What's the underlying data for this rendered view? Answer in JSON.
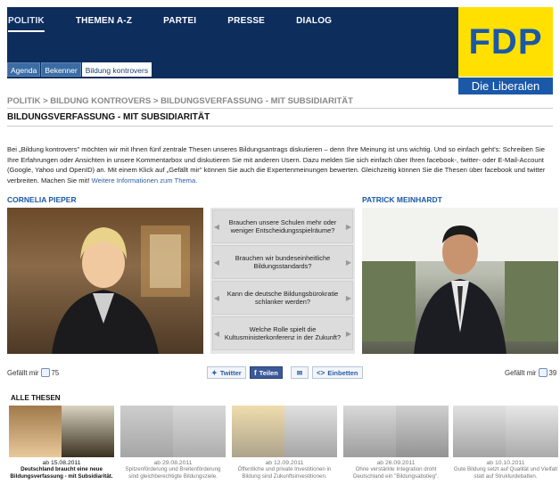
{
  "nav": {
    "items": [
      "POLITIK",
      "THEMEN A-Z",
      "PARTEI",
      "PRESSE",
      "DIALOG"
    ]
  },
  "subtabs": [
    "Agenda",
    "Bekenner",
    "Bildung kontrovers"
  ],
  "logo": {
    "name": "FDP",
    "tagline": "Die Liberalen"
  },
  "breadcrumb": "POLITIK > BILDUNG KONTROVERS > BILDUNGSVERFASSUNG - MIT SUBSIDIARITÄT",
  "page_title": "BILDUNGSVERFASSUNG - MIT SUBSIDIARITÄT",
  "intro": {
    "text": "Bei „Bildung kontrovers\" möchten wir mit Ihnen fünf zentrale Thesen unseres Bildungsantrags diskutieren – denn Ihre Meinung ist uns wichtig. Und so einfach geht's: Schreiben Sie Ihre Erfahrungen oder Ansichten in unsere Kommentarbox und diskutieren Sie mit anderen Usern. Dazu melden Sie sich einfach über Ihren facebook-, twitter- oder E-Mail-Account (Google, Yahoo und OpenID) an. Mit einem Klick auf „Gefällt mir\" können Sie auch die Expertenmeinungen bewerten. Gleichzeitig können Sie die Thesen über facebook und twitter verbreiten. Machen Sie mit!",
    "link": "Weitere Informationen zum Thema."
  },
  "persons": {
    "left": {
      "name": "CORNELIA PIEPER",
      "likes_label": "Gefällt mir",
      "likes": "75"
    },
    "right": {
      "name": "PATRICK MEINHARDT",
      "likes_label": "Gefällt mir",
      "likes": "39"
    }
  },
  "theses": [
    "Brauchen unsere Schulen mehr oder weniger Entscheidungsspielräume?",
    "Brauchen wir bundeseinheitliche Bildungsstandards?",
    "Kann die deutsche Bildungsbürokratie schlanker werden?",
    "Welche Rolle spielt die Kultusministerkonferenz in der Zukunft?"
  ],
  "share": {
    "twitter": "Twitter",
    "facebook": "Teilen",
    "embed": "Einbetten"
  },
  "alle_thesen": {
    "heading": "ALLE THESEN",
    "cards": [
      {
        "date": "ab 15.08.2011",
        "text": "Deutschland braucht eine neue Bildungsverfassung - mit Subsidiarität."
      },
      {
        "date": "ab 29.08.2011",
        "text": "Spitzenförderung und Breitenförderung sind gleichberechtigte Bildungsziele."
      },
      {
        "date": "ab 12.09.2011",
        "text": "Öffentliche und private Investitionen in Bildung sind Zukunftsinvestitionen."
      },
      {
        "date": "ab 26.09.2011",
        "text": "Ohne verstärkte Integration droht Deutschland ein \"Bildungsabstieg\"."
      },
      {
        "date": "ab 10.10.2011",
        "text": "Gute Bildung setzt auf Qualität und Vielfalt statt auf Strukturdebatten."
      }
    ]
  },
  "colors": {
    "header_bg": "#0d2d5c",
    "logo_yellow": "#ffe000",
    "logo_blue": "#1a58a8",
    "name_blue": "#1a58a8"
  }
}
